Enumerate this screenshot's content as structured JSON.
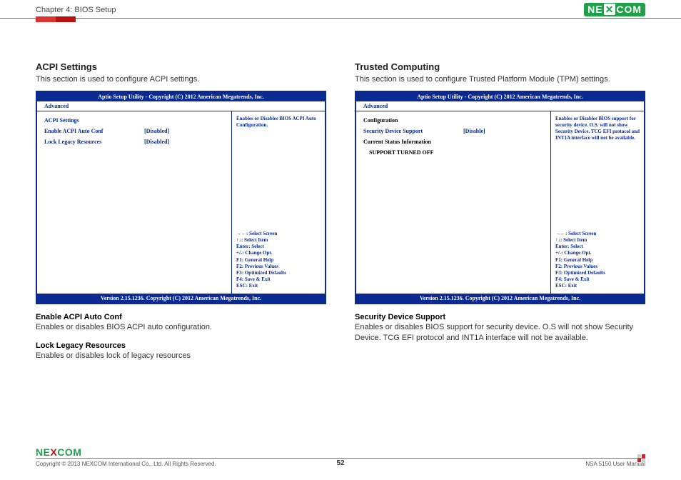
{
  "header": {
    "chapter": "Chapter 4: BIOS Setup",
    "logo_text": "NE COM",
    "logo_x": "X"
  },
  "left": {
    "title": "ACPI Settings",
    "desc": "This section is used to configure ACPI settings.",
    "bios": {
      "title": "Aptio Setup Utility - Copyright (C) 2012 American Megatrends, Inc.",
      "tab": "Advanced",
      "heading": "ACPI Settings",
      "rows": [
        {
          "label": "Enable ACPI Auto Conf",
          "value": "[Disabled]"
        },
        {
          "label": "Lock Legacy Resources",
          "value": "[Disabled]"
        }
      ],
      "help": "Enables or Disables BIOS ACPI Auto Configuration.",
      "keys": [
        "→←: Select Screen",
        "↑↓: Select Item",
        "Enter: Select",
        "+/-: Change Opt.",
        "F1: General Help",
        "F2: Previous Values",
        "F3: Optimized Defaults",
        "F4: Save & Exit",
        "ESC: Exit"
      ],
      "footer": "Version 2.15.1236. Copyright (C) 2012 American Megatrends, Inc."
    },
    "subs": [
      {
        "title": "Enable ACPI Auto Conf",
        "desc": "Enables or disables BIOS ACPI auto configuration."
      },
      {
        "title": "Lock Legacy Resources",
        "desc": "Enables or disables lock of legacy resources"
      }
    ]
  },
  "right": {
    "title": "Trusted Computing",
    "desc": "This section is used to configure Trusted Platform Module (TPM) settings.",
    "bios": {
      "title": "Aptio Setup Utility - Copyright (C) 2012 American Megatrends, Inc.",
      "tab": "Advanced",
      "heading": "Configuration",
      "rows": [
        {
          "label": "Security Device Support",
          "value": "[Disable]"
        }
      ],
      "status_label": "Current Status Information",
      "status_value": "SUPPORT TURNED OFF",
      "help": "Enables or Disables BIOS support for security device. O.S. will not show Security Device. TCG EFI protocol and INT1A interface will not be available.",
      "keys": [
        "→←: Select Screen",
        "↑↓: Select Item",
        "Enter: Select",
        "+/-: Change Opt.",
        "F1: General Help",
        "F2: Previous Values",
        "F3: Optimized Defaults",
        "F4: Save & Exit",
        "ESC: Exit"
      ],
      "footer": "Version 2.15.1236. Copyright (C) 2012 American Megatrends, Inc."
    },
    "subs": [
      {
        "title": "Security Device Support",
        "desc": "Enables or disables BIOS support for security device. O.S will not show Security Device. TCG EFI protocol and INT1A interface will not be available."
      }
    ]
  },
  "footer": {
    "logo_pre": "NE",
    "logo_x": "X",
    "logo_post": "COM",
    "copyright": "Copyright © 2013 NEXCOM International Co., Ltd. All Rights Reserved.",
    "page": "52",
    "manual": "NSA 5150 User Manual"
  }
}
